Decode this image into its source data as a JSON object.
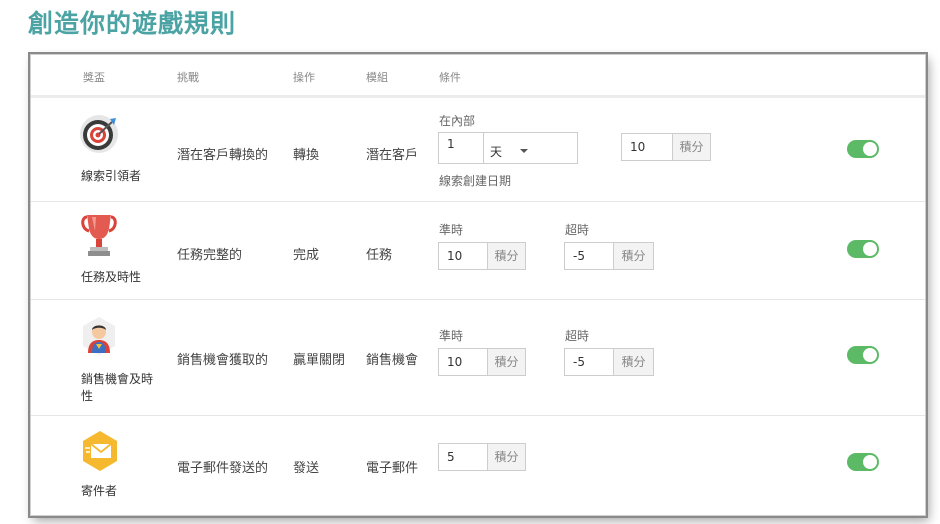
{
  "page": {
    "title": "創造你的遊戲規則"
  },
  "table": {
    "headers": {
      "reward": "獎盃",
      "challenge": "挑戰",
      "action": "操作",
      "module": "模組",
      "condition": "條件"
    }
  },
  "rows": [
    {
      "reward": "線索引領者",
      "challenge": "潛在客戶轉換的",
      "action": "轉換",
      "module": "潛在客戶",
      "within_label": "在內部",
      "duration_value": "1",
      "duration_unit": "天",
      "date_note": "線索創建日期",
      "points": "10",
      "points_unit": "積分",
      "enabled": true
    },
    {
      "reward": "任務及時性",
      "challenge": "任務完整的",
      "action": "完成",
      "module": "任務",
      "ontime_label": "準時",
      "ontime_points": "10",
      "overdue_label": "超時",
      "overdue_points": "-5",
      "points_unit": "積分",
      "enabled": true
    },
    {
      "reward": "銷售機會及時性",
      "challenge": "銷售機會獲取的",
      "action": "贏單關閉",
      "module": "銷售機會",
      "ontime_label": "準時",
      "ontime_points": "10",
      "overdue_label": "超時",
      "overdue_points": "-5",
      "points_unit": "積分",
      "enabled": true
    },
    {
      "reward": "寄件者",
      "challenge": "電子郵件發送的",
      "action": "發送",
      "module": "電子郵件",
      "points": "5",
      "points_unit": "積分",
      "enabled": true
    }
  ],
  "icons": {
    "row1": "target-icon",
    "row2": "trophy-icon",
    "row3": "superhero-icon",
    "row4": "envelope-badge-icon"
  },
  "colors": {
    "accent": "#4ba3a3",
    "toggle_on": "#5cba66"
  }
}
